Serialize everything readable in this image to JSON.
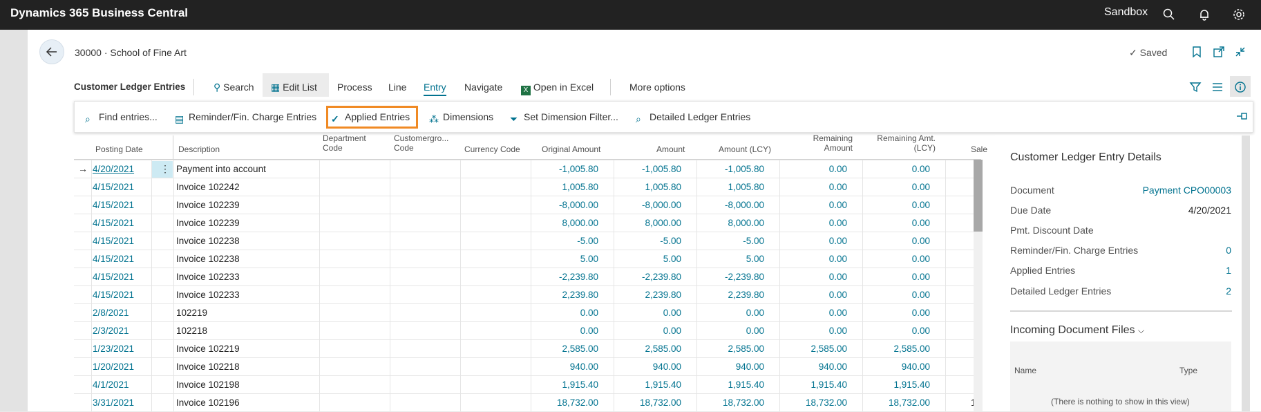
{
  "topbar": {
    "title": "Dynamics 365 Business Central",
    "environment": "Sandbox"
  },
  "header": {
    "record_title": "30000 · School of Fine Art",
    "saved_label": "Saved"
  },
  "actionbar": {
    "page_name": "Customer Ledger Entries",
    "search": "Search",
    "edit_list": "Edit List",
    "process": "Process",
    "line": "Line",
    "entry": "Entry",
    "navigate": "Navigate",
    "open_in_excel": "Open in Excel",
    "more_options": "More options"
  },
  "subactions": {
    "find_entries": "Find entries...",
    "reminder": "Reminder/Fin. Charge Entries",
    "applied": "Applied Entries",
    "dimensions": "Dimensions",
    "set_dim_filter": "Set Dimension Filter...",
    "detailed": "Detailed Ledger Entries"
  },
  "columns": {
    "posting_date": "Posting Date",
    "description": "Description",
    "department_1": "Department",
    "department_2": "Code",
    "custgroup_1": "Customergro...",
    "custgroup_2": "Code",
    "currency": "Currency Code",
    "original": "Original Amount",
    "amount": "Amount",
    "amount_lcy": "Amount (LCY)",
    "remaining_1": "Remaining",
    "remaining_2": "Amount",
    "remaining_lcy_1": "Remaining Amt.",
    "remaining_lcy_2": "(LCY)",
    "sales_partial": "Sale"
  },
  "rows": [
    {
      "date": "4/20/2021",
      "desc": "Payment into account",
      "orig": "-1,005.80",
      "amt": "-1,005.80",
      "lcy": "-1,005.80",
      "rem": "0.00",
      "remlcy": "0.00",
      "sale": ""
    },
    {
      "date": "4/15/2021",
      "desc": "Invoice 102242",
      "orig": "1,005.80",
      "amt": "1,005.80",
      "lcy": "1,005.80",
      "rem": "0.00",
      "remlcy": "0.00",
      "sale": ""
    },
    {
      "date": "4/15/2021",
      "desc": "Invoice 102239",
      "orig": "-8,000.00",
      "amt": "-8,000.00",
      "lcy": "-8,000.00",
      "rem": "0.00",
      "remlcy": "0.00",
      "sale": ""
    },
    {
      "date": "4/15/2021",
      "desc": "Invoice 102239",
      "orig": "8,000.00",
      "amt": "8,000.00",
      "lcy": "8,000.00",
      "rem": "0.00",
      "remlcy": "0.00",
      "sale": ""
    },
    {
      "date": "4/15/2021",
      "desc": "Invoice 102238",
      "orig": "-5.00",
      "amt": "-5.00",
      "lcy": "-5.00",
      "rem": "0.00",
      "remlcy": "0.00",
      "sale": ""
    },
    {
      "date": "4/15/2021",
      "desc": "Invoice 102238",
      "orig": "5.00",
      "amt": "5.00",
      "lcy": "5.00",
      "rem": "0.00",
      "remlcy": "0.00",
      "sale": ""
    },
    {
      "date": "4/15/2021",
      "desc": "Invoice 102233",
      "orig": "-2,239.80",
      "amt": "-2,239.80",
      "lcy": "-2,239.80",
      "rem": "0.00",
      "remlcy": "0.00",
      "sale": ""
    },
    {
      "date": "4/15/2021",
      "desc": "Invoice 102233",
      "orig": "2,239.80",
      "amt": "2,239.80",
      "lcy": "2,239.80",
      "rem": "0.00",
      "remlcy": "0.00",
      "sale": ""
    },
    {
      "date": "2/8/2021",
      "desc": "102219",
      "orig": "0.00",
      "amt": "0.00",
      "lcy": "0.00",
      "rem": "0.00",
      "remlcy": "0.00",
      "sale": ""
    },
    {
      "date": "2/3/2021",
      "desc": "102218",
      "orig": "0.00",
      "amt": "0.00",
      "lcy": "0.00",
      "rem": "0.00",
      "remlcy": "0.00",
      "sale": ""
    },
    {
      "date": "1/23/2021",
      "desc": "Invoice 102219",
      "orig": "2,585.00",
      "amt": "2,585.00",
      "lcy": "2,585.00",
      "rem": "2,585.00",
      "remlcy": "2,585.00",
      "sale": ""
    },
    {
      "date": "1/20/2021",
      "desc": "Invoice 102218",
      "orig": "940.00",
      "amt": "940.00",
      "lcy": "940.00",
      "rem": "940.00",
      "remlcy": "940.00",
      "sale": ""
    },
    {
      "date": "4/1/2021",
      "desc": "Invoice 102198",
      "orig": "1,915.40",
      "amt": "1,915.40",
      "lcy": "1,915.40",
      "rem": "1,915.40",
      "remlcy": "1,915.40",
      "sale": ""
    },
    {
      "date": "3/31/2021",
      "desc": "Invoice 102196",
      "orig": "18,732.00",
      "amt": "18,732.00",
      "lcy": "18,732.00",
      "rem": "18,732.00",
      "remlcy": "18,732.00",
      "sale": "1"
    }
  ],
  "factbox": {
    "title": "Customer Ledger Entry Details",
    "document_label": "Document",
    "document_value": "Payment CPO00003",
    "due_date_label": "Due Date",
    "due_date_value": "4/20/2021",
    "pmt_discount_label": "Pmt. Discount Date",
    "reminder_label": "Reminder/Fin. Charge Entries",
    "reminder_value": "0",
    "applied_label": "Applied Entries",
    "applied_value": "1",
    "detailed_label": "Detailed Ledger Entries",
    "detailed_value": "2",
    "incoming_title": "Incoming Document Files",
    "col_name": "Name",
    "col_type": "Type",
    "empty_text": "(There is nothing to show in this view)"
  },
  "colors": {
    "accent": "#00728f",
    "highlight": "#f08a24",
    "topbar": "#222222"
  }
}
